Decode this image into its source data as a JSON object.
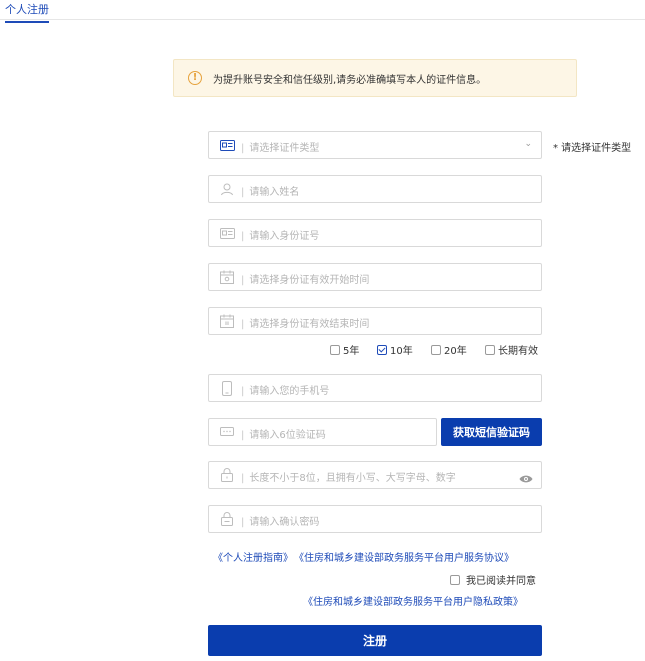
{
  "tab": {
    "label": "个人注册"
  },
  "notice": {
    "text": "为提升账号安全和信任级别,请务必准确填写本人的证件信息。"
  },
  "form": {
    "id_type": {
      "placeholder": "请选择证件类型",
      "hint": "* 请选择证件类型"
    },
    "name": {
      "placeholder": "请输入姓名"
    },
    "id_number": {
      "placeholder": "请输入身份证号"
    },
    "start_date": {
      "placeholder": "请选择身份证有效开始时间"
    },
    "end_date": {
      "placeholder": "请选择身份证有效结束时间"
    },
    "validity_options": [
      {
        "label": "5年",
        "checked": false
      },
      {
        "label": "10年",
        "checked": true
      },
      {
        "label": "20年",
        "checked": false
      },
      {
        "label": "长期有效",
        "checked": false
      }
    ],
    "phone": {
      "placeholder": "请输入您的手机号"
    },
    "sms_code": {
      "placeholder": "请输入6位验证码",
      "button": "获取短信验证码"
    },
    "password": {
      "placeholder": "长度不小于8位，且拥有小写、大写字母、数字"
    },
    "confirm_password": {
      "placeholder": "请输入确认密码"
    }
  },
  "links": {
    "guide": "《个人注册指南》",
    "service_agreement": "《住房和城乡建设部政务服务平台用户服务协议》",
    "agree_label": "我已阅读并同意",
    "privacy_policy": "《住房和城乡建设部政务服务平台用户隐私政策》"
  },
  "submit": {
    "label": "注册"
  },
  "colors": {
    "primary": "#0a3dae",
    "link": "#1e4bb8",
    "notice_bg": "#fdf6e6",
    "warning": "#e6a23c"
  }
}
